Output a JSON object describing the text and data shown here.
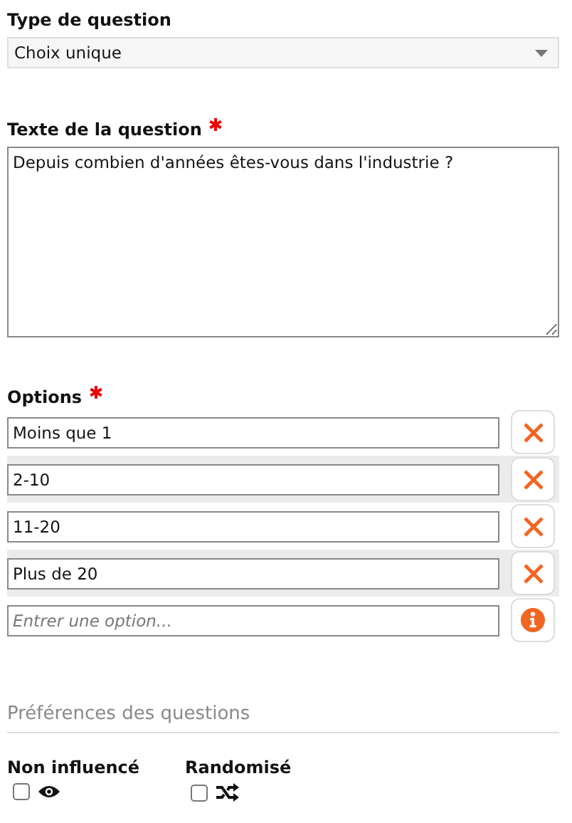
{
  "question_type": {
    "label": "Type de question",
    "value": "Choix unique"
  },
  "question_text": {
    "label": "Texte de la question",
    "required": true,
    "value": "Depuis combien d'années êtes-vous dans l'industrie ?"
  },
  "options": {
    "label": "Options",
    "required": true,
    "items": [
      {
        "kind": "option",
        "value": "Moins que 1",
        "highlighted": false
      },
      {
        "kind": "option",
        "value": "2-10",
        "highlighted": true
      },
      {
        "kind": "option",
        "value": "11-20",
        "highlighted": false
      },
      {
        "kind": "option",
        "value": "Plus de 20",
        "highlighted": true
      },
      {
        "kind": "new",
        "placeholder": "Entrer une option...",
        "highlighted": false
      }
    ]
  },
  "preferences": {
    "title": "Préférences des questions",
    "items": [
      {
        "label": "Non influencé",
        "kind": "unbiased",
        "checked": false
      },
      {
        "label": "Randomisé",
        "kind": "randomized",
        "checked": false
      }
    ]
  }
}
